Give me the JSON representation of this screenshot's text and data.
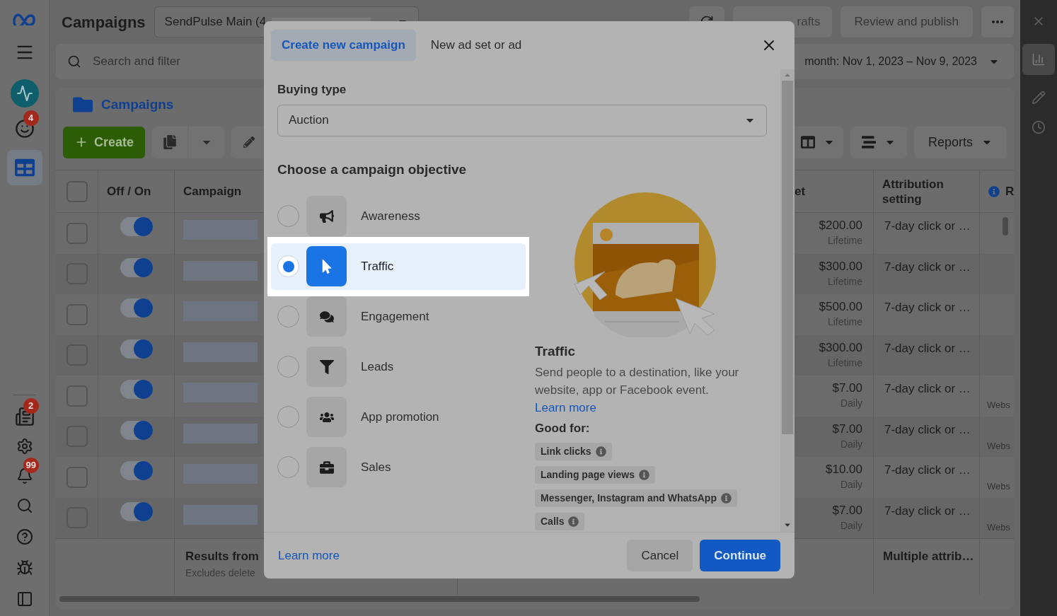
{
  "header": {
    "title": "Campaigns",
    "account": "SendPulse Main (4",
    "discard": "rafts",
    "publish": "Review and publish"
  },
  "search": {
    "placeholder": "Search and filter",
    "date_range": "month: Nov 1, 2023 – Nov 9, 2023"
  },
  "nav": {
    "badges": [
      "4",
      "2",
      "99"
    ]
  },
  "panel": {
    "tab": "Campaigns",
    "create": "Create",
    "reports": "Reports"
  },
  "table": {
    "select_all_checked": false,
    "columns": [
      "Off / On",
      "Campaign",
      "et",
      "Attribution setting",
      "R"
    ],
    "rows": [
      {
        "checked": false,
        "on": true,
        "budget": "$200.00",
        "period": "Lifetime",
        "attribution": "7-day click or …",
        "column_r": ""
      },
      {
        "checked": false,
        "on": true,
        "budget": "$300.00",
        "period": "Lifetime",
        "attribution": "7-day click or …",
        "column_r": ""
      },
      {
        "checked": false,
        "on": true,
        "budget": "$500.00",
        "period": "Lifetime",
        "attribution": "7-day click or …",
        "column_r": ""
      },
      {
        "checked": false,
        "on": true,
        "budget": "$300.00",
        "period": "Lifetime",
        "attribution": "7-day click or …",
        "column_r": ""
      },
      {
        "checked": false,
        "on": true,
        "budget": "$7.00",
        "period": "Daily",
        "attribution": "7-day click or …",
        "column_r": "Webs"
      },
      {
        "checked": false,
        "on": true,
        "budget": "$7.00",
        "period": "Daily",
        "attribution": "7-day click or …",
        "column_r": "Webs"
      },
      {
        "checked": false,
        "on": true,
        "budget": "$10.00",
        "period": "Daily",
        "attribution": "7-day click or …",
        "column_r": "Webs"
      },
      {
        "checked": false,
        "on": true,
        "budget": "$7.00",
        "period": "Daily",
        "attribution": "7-day click or …",
        "column_r": "Webs"
      }
    ],
    "footer": {
      "results": "Results from",
      "note": "Excludes delete",
      "attribution": "Multiple attrib…"
    }
  },
  "dialog": {
    "tabs": [
      {
        "label": "Create new campaign",
        "selected": true
      },
      {
        "label": "New ad set or ad",
        "selected": false
      }
    ],
    "buying_type": {
      "label": "Buying type",
      "value": "Auction"
    },
    "objective_heading": "Choose a campaign objective",
    "objectives": [
      {
        "kind": "awareness",
        "label": "Awareness",
        "selected": false
      },
      {
        "kind": "traffic",
        "label": "Traffic",
        "selected": true
      },
      {
        "kind": "engagement",
        "label": "Engagement",
        "selected": false
      },
      {
        "kind": "leads",
        "label": "Leads",
        "selected": false
      },
      {
        "kind": "app",
        "label": "App promotion",
        "selected": false
      },
      {
        "kind": "sales",
        "label": "Sales",
        "selected": false
      }
    ],
    "detail": {
      "title": "Traffic",
      "description": "Send people to a destination, like your website, app or Facebook event.",
      "link": "Learn more",
      "good_for": "Good for:",
      "tags": [
        "Link clicks",
        "Landing page views",
        "Messenger, Instagram and WhatsApp",
        "Calls"
      ]
    },
    "footer": {
      "link": "Learn more",
      "cancel": "Cancel",
      "continue": "Continue"
    }
  }
}
